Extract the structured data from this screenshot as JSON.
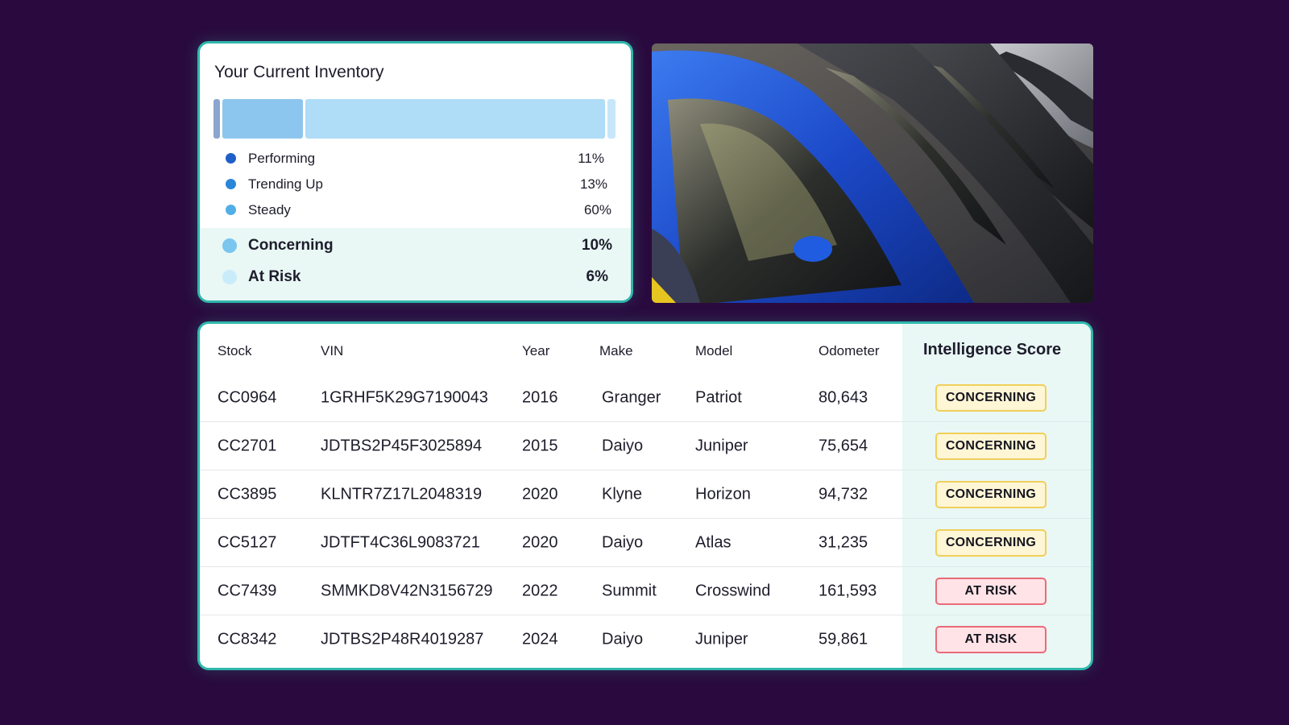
{
  "inventory": {
    "title": "Your Current Inventory",
    "bar_segments": [
      {
        "name": "performing",
        "fraction": 0.011,
        "color": "#8aa6cf"
      },
      {
        "name": "trending-up",
        "fraction": 0.2,
        "color": "#8cc6ee"
      },
      {
        "name": "steady",
        "fraction": 0.75,
        "color": "#afdcf6"
      },
      {
        "name": "tail",
        "fraction": 0.02,
        "color": "#c6e7fa"
      }
    ],
    "legend": [
      {
        "label": "Performing",
        "pct": "11%",
        "color": "#1f5fc8"
      },
      {
        "label": "Trending Up",
        "pct": "13%",
        "color": "#2a86d9"
      },
      {
        "label": "Steady",
        "pct": "60%",
        "color": "#52aee6"
      },
      {
        "label": "Concerning",
        "pct": "10%",
        "color": "#7ac6ef"
      },
      {
        "label": "At Risk",
        "pct": "6%",
        "color": "#c9ecfb"
      }
    ]
  },
  "table": {
    "headers": {
      "stock": "Stock",
      "vin": "VIN",
      "year": "Year",
      "make": "Make",
      "model": "Model",
      "odometer": "Odometer",
      "score": "Intelligence Score"
    },
    "rows": [
      {
        "stock": "CC0964",
        "vin": "1GRHF5K29G7190043",
        "year": "2016",
        "make": "Granger",
        "model": "Patriot",
        "odometer": "80,643",
        "score": "CONCERNING"
      },
      {
        "stock": "CC2701",
        "vin": "JDTBS2P45F3025894",
        "year": "2015",
        "make": "Daiyo",
        "model": "Juniper",
        "odometer": "75,654",
        "score": "CONCERNING"
      },
      {
        "stock": "CC3895",
        "vin": "KLNTR7Z17L2048319",
        "year": "2020",
        "make": "Klyne",
        "model": "Horizon",
        "odometer": "94,732",
        "score": "CONCERNING"
      },
      {
        "stock": "CC5127",
        "vin": "JDTFT4C36L9083721",
        "year": "2020",
        "make": "Daiyo",
        "model": "Atlas",
        "odometer": "31,235",
        "score": "CONCERNING"
      },
      {
        "stock": "CC7439",
        "vin": "SMMKD8V42N3156729",
        "year": "2022",
        "make": "Summit",
        "model": "Crosswind",
        "odometer": "161,593",
        "score": "AT RISK"
      },
      {
        "stock": "CC8342",
        "vin": "JDTBS2P48R4019287",
        "year": "2024",
        "make": "Daiyo",
        "model": "Juniper",
        "odometer": "59,861",
        "score": "AT RISK"
      }
    ],
    "badge_styles": {
      "CONCERNING": {
        "bg": "#fff6d6",
        "border": "#f0cf5a"
      },
      "AT RISK": {
        "bg": "#ffe3e6",
        "border": "#ea6b78"
      }
    }
  },
  "photo": {
    "subject": "row of parked cars with blue car in front"
  }
}
